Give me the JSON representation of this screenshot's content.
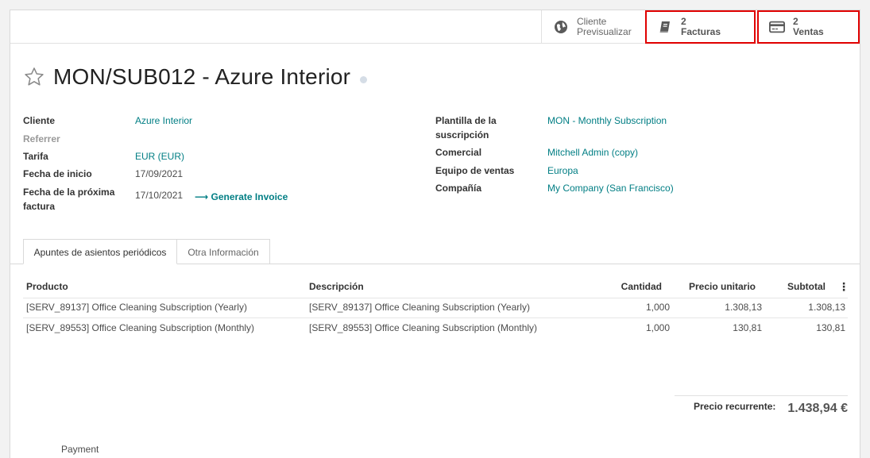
{
  "smart_buttons": {
    "preview": {
      "line1": "Cliente",
      "line2": "Previsualizar",
      "icon": "globe-icon"
    },
    "invoices": {
      "value": "2",
      "label": "Facturas",
      "icon": "book-icon"
    },
    "sales": {
      "value": "2",
      "label": "Ventas",
      "icon": "card-icon"
    }
  },
  "record": {
    "title": "MON/SUB012 - Azure Interior"
  },
  "left_fields": {
    "customer_label": "Cliente",
    "customer_value": "Azure Interior",
    "referrer_label": "Referrer",
    "pricelist_label": "Tarifa",
    "pricelist_value": "EUR (EUR)",
    "start_date_label": "Fecha de inicio",
    "start_date_value": "17/09/2021",
    "next_invoice_label_1": "Fecha de la próxima",
    "next_invoice_label_2": "factura",
    "next_invoice_value": "17/10/2021",
    "generate_invoice": "Generate Invoice"
  },
  "right_fields": {
    "template_label_1": "Plantilla de la",
    "template_label_2": "suscripción",
    "template_value": "MON - Monthly Subscription",
    "salesperson_label": "Comercial",
    "salesperson_value": "Mitchell Admin (copy)",
    "sales_team_label": "Equipo de ventas",
    "sales_team_value": "Europa",
    "company_label": "Compañía",
    "company_value": "My Company (San Francisco)"
  },
  "tabs": {
    "active": "Apuntes de asientos periódicos",
    "other": "Otra Información"
  },
  "table": {
    "headers": {
      "product": "Producto",
      "description": "Descripción",
      "quantity": "Cantidad",
      "unit_price": "Precio unitario",
      "subtotal": "Subtotal"
    },
    "rows": [
      {
        "product": "[SERV_89137] Office Cleaning Subscription (Yearly)",
        "description": "[SERV_89137] Office Cleaning Subscription (Yearly)",
        "quantity": "1,000",
        "unit_price": "1.308,13",
        "subtotal": "1.308,13"
      },
      {
        "product": "[SERV_89553] Office Cleaning Subscription (Monthly)",
        "description": "[SERV_89553] Office Cleaning Subscription (Monthly)",
        "quantity": "1,000",
        "unit_price": "130,81",
        "subtotal": "130,81"
      }
    ]
  },
  "totals": {
    "recurring_label": "Precio recurrente:",
    "recurring_value": "1.438,94 €"
  },
  "footer": {
    "payment_label": "Payment"
  },
  "colors": {
    "link": "#017e84",
    "highlight": "#e00000"
  }
}
